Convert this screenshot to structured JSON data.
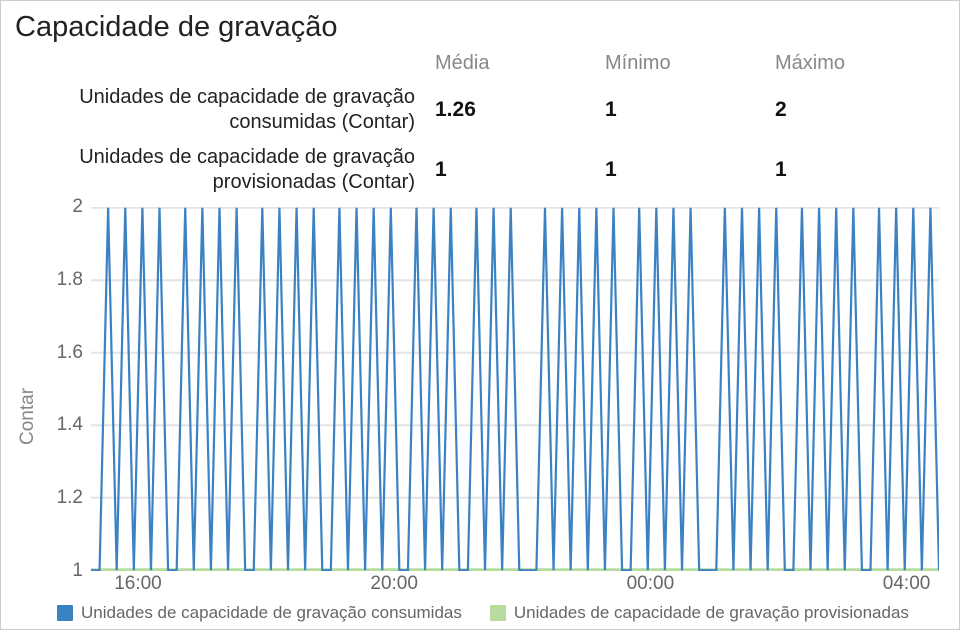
{
  "title": "Capacidade de gravação",
  "stats": {
    "headers": [
      "Média",
      "Mínimo",
      "Máximo"
    ],
    "rows": [
      {
        "label": "Unidades de capacidade de gravação consumidas (Contar)",
        "values": [
          "1.26",
          "1",
          "2"
        ]
      },
      {
        "label": "Unidades de capacidade de gravação provisionadas (Contar)",
        "values": [
          "1",
          "1",
          "1"
        ]
      }
    ]
  },
  "legend": [
    {
      "label": "Unidades de capacidade de gravação consumidas",
      "color": "#3b82c4"
    },
    {
      "label": "Unidades de capacidade de gravação provisionadas",
      "color": "#b8dca0"
    }
  ],
  "chart_data": {
    "type": "line",
    "ylabel": "Contar",
    "ylim": [
      1,
      2
    ],
    "yticks": [
      1,
      1.2,
      1.4,
      1.6,
      1.8,
      2
    ],
    "x_ticks": [
      "16:00",
      "20:00",
      "00:00",
      "04:00"
    ],
    "x_tick_positions": [
      0.055,
      0.355,
      0.655,
      0.955
    ],
    "x_range_minutes": 804,
    "series": [
      {
        "name": "Unidades de capacidade de gravação consumidas",
        "color": "#3b82c4",
        "values": [
          1,
          1,
          2,
          1,
          2,
          1,
          2,
          1,
          2,
          1,
          1,
          2,
          1,
          2,
          1,
          2,
          1,
          2,
          1,
          1,
          2,
          1,
          2,
          1,
          2,
          1,
          2,
          1,
          1,
          2,
          1,
          2,
          1,
          2,
          1,
          2,
          1,
          1,
          2,
          1,
          2,
          1,
          2,
          1,
          1,
          2,
          1,
          2,
          1,
          2,
          1,
          1,
          1,
          2,
          1,
          2,
          1,
          2,
          1,
          2,
          1,
          2,
          1,
          1,
          2,
          1,
          2,
          1,
          2,
          1,
          2,
          1,
          1,
          1,
          2,
          1,
          2,
          1,
          2,
          1,
          2,
          1,
          1,
          2,
          1,
          2,
          1,
          2,
          1,
          2,
          1,
          1,
          2,
          1,
          2,
          1,
          2,
          1,
          2,
          1
        ]
      },
      {
        "name": "Unidades de capacidade de gravação provisionadas",
        "color": "#b8dca0",
        "values_constant": 1,
        "n_points": 100
      }
    ]
  }
}
